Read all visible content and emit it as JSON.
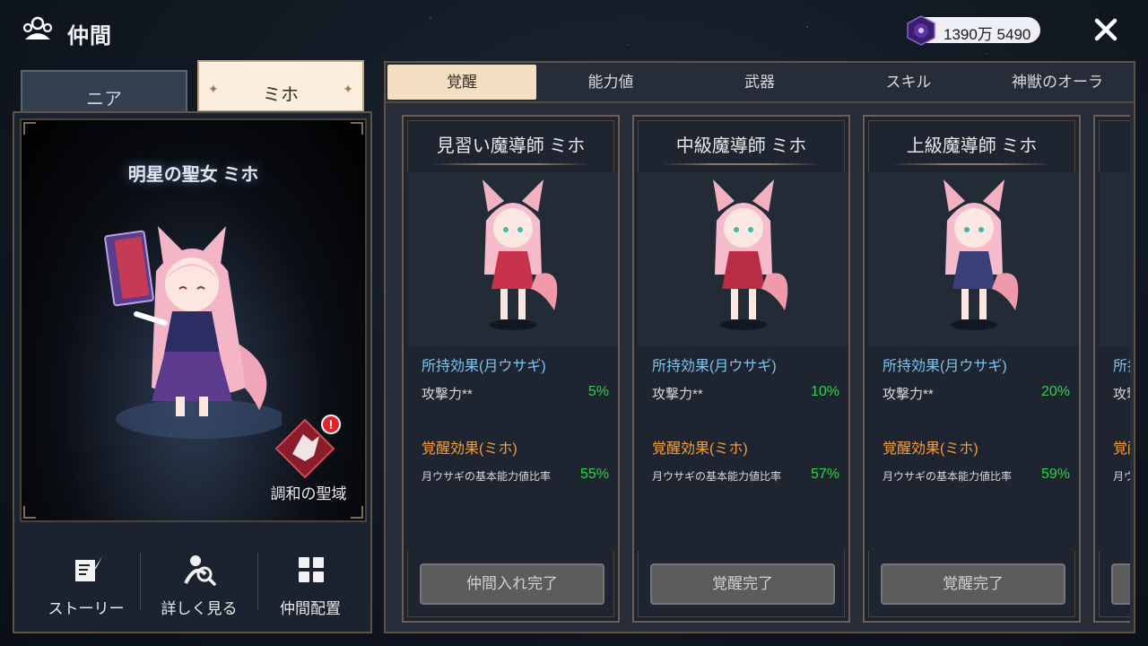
{
  "header": {
    "title": "仲間",
    "currency": "1390万 5490"
  },
  "character_tabs": [
    {
      "label": "ニア",
      "active": false
    },
    {
      "label": "ミホ",
      "active": true
    }
  ],
  "portrait": {
    "name": "明星の聖女 ミホ",
    "sanctuary_label": "調和の聖域",
    "alert": "!"
  },
  "left_actions": [
    {
      "label": "ストーリー",
      "icon": "quill-scroll-icon"
    },
    {
      "label": "詳しく見る",
      "icon": "magnify-person-icon"
    },
    {
      "label": "仲間配置",
      "icon": "grid-icon"
    }
  ],
  "tabs": [
    {
      "label": "覚醒",
      "active": true
    },
    {
      "label": "能力値",
      "active": false
    },
    {
      "label": "武器",
      "active": false
    },
    {
      "label": "スキル",
      "active": false
    },
    {
      "label": "神獣のオーラ",
      "active": false
    }
  ],
  "cards": [
    {
      "title": "見習い魔導師 ミホ",
      "own_header": "所持効果(月ウサギ)",
      "own_label": "攻撃力**",
      "own_value": "5%",
      "awaken_header": "覚醒効果(ミホ)",
      "awaken_label": "月ウサギの基本能力値比率",
      "awaken_value": "55%",
      "button": "仲間入れ完了",
      "dress": "#c8324a"
    },
    {
      "title": "中級魔導師 ミホ",
      "own_header": "所持効果(月ウサギ)",
      "own_label": "攻撃力**",
      "own_value": "10%",
      "awaken_header": "覚醒効果(ミホ)",
      "awaken_label": "月ウサギの基本能力値比率",
      "awaken_value": "57%",
      "button": "覚醒完了",
      "dress": "#b82c44"
    },
    {
      "title": "上級魔導師 ミホ",
      "own_header": "所持効果(月ウサギ)",
      "own_label": "攻撃力**",
      "own_value": "20%",
      "awaken_header": "覚醒効果(ミホ)",
      "awaken_label": "月ウサギの基本能力値比率",
      "awaken_value": "59%",
      "button": "覚醒完了",
      "dress": "#3a3f7a"
    }
  ],
  "partial_card": {
    "own_header": "所持",
    "own_label": "攻撃",
    "awaken_header": "覚醒",
    "awaken_label": "月ウ"
  },
  "colors": {
    "accent_tab": "#f2dfc4",
    "stat_green": "#2fd14a",
    "header_blue": "#7bc4f0",
    "header_orange": "#f0a040"
  }
}
